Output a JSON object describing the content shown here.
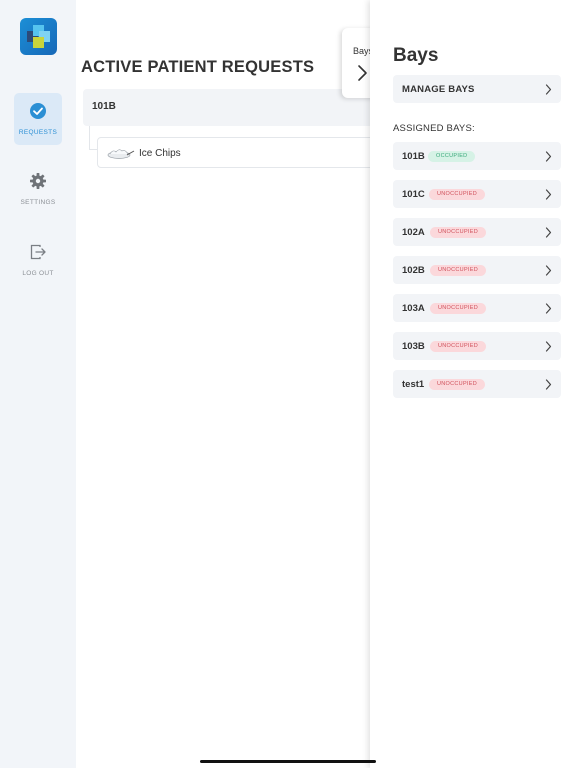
{
  "sidebar": {
    "items": [
      {
        "label": "REQUESTS",
        "icon": "check-circle-icon",
        "active": true
      },
      {
        "label": "SETTINGS",
        "icon": "gear-icon",
        "active": false
      },
      {
        "label": "LOG OUT",
        "icon": "logout-icon",
        "active": false
      }
    ]
  },
  "main": {
    "title": "ACTIVE PATIENT REQUESTS",
    "requests": [
      {
        "bay": "101B",
        "items": [
          {
            "label": "Ice Chips",
            "icon": "ice-chips-icon"
          }
        ]
      }
    ]
  },
  "drawer": {
    "tab_label": "Bays",
    "title": "Bays",
    "manage_label": "MANAGE BAYS",
    "assigned_label": "ASSIGNED BAYS:",
    "bays": [
      {
        "name": "101B",
        "status": "OCCUPIED"
      },
      {
        "name": "101C",
        "status": "UNOCCUPIED"
      },
      {
        "name": "102A",
        "status": "UNOCCUPIED"
      },
      {
        "name": "102B",
        "status": "UNOCCUPIED"
      },
      {
        "name": "103A",
        "status": "UNOCCUPIED"
      },
      {
        "name": "103B",
        "status": "UNOCCUPIED"
      },
      {
        "name": "test1",
        "status": "UNOCCUPIED"
      }
    ]
  },
  "colors": {
    "accent": "#2b8fd4",
    "sidebar_bg": "#f2f5f9",
    "occupied_bg": "#d6f2e6",
    "occupied_text": "#3aa97a",
    "unoccupied_bg": "#fbd8db",
    "unoccupied_text": "#d0505b"
  }
}
